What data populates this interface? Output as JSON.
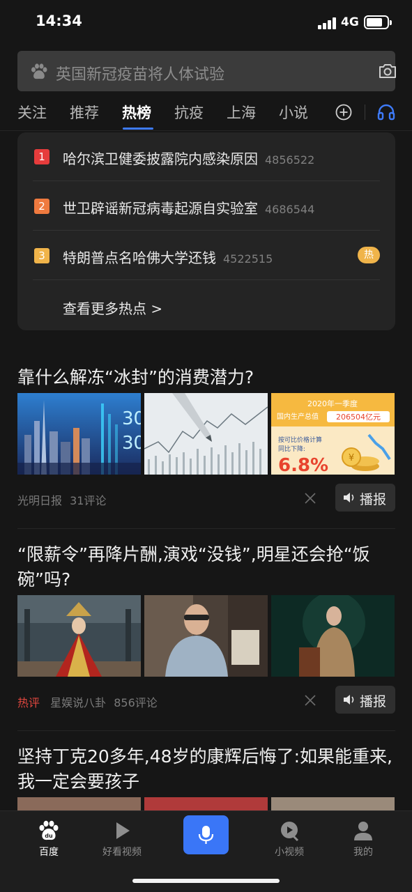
{
  "status_bar": {
    "time": "14:34",
    "network": "4G"
  },
  "search": {
    "query": "英国新冠疫苗将人体试验",
    "left_icon": "baidu-paw-icon",
    "right_icon": "camera-icon"
  },
  "tabs": {
    "items": [
      "关注",
      "推荐",
      "热榜",
      "抗疫",
      "上海",
      "小说"
    ],
    "active_index": 2,
    "accent": "#3e7bfa"
  },
  "hot_list": {
    "items": [
      {
        "rank": "1",
        "title": "哈尔滨卫健委披露院内感染原因",
        "count": "4856522",
        "rank_color": "#e63c3c"
      },
      {
        "rank": "2",
        "title": "世卫辟谣新冠病毒起源自实验室",
        "count": "4686544",
        "rank_color": "#ef7a3f"
      },
      {
        "rank": "3",
        "title": "特朗普点名哈佛大学还钱",
        "count": "4522515",
        "rank_color": "#f0b44a",
        "badge": "热"
      }
    ],
    "more_label": "查看更多热点 >"
  },
  "news": [
    {
      "title": "靠什么解冻“冰封”的消费潜力?",
      "thumb3": {
        "year": "2020年一季度",
        "gdp_label": "国内生产总值",
        "gdp_value": "206504亿元",
        "calc": "按可比价格计算",
        "change": "同比下降:",
        "percent": "6.8%"
      },
      "source": "光明日报",
      "comments": "31评论",
      "play_label": "播报"
    },
    {
      "title": "“限薪令”再降片酬,演戏“没钱”,明星还会抢“饭碗”吗?",
      "tag": "热评",
      "source": "星娱说八卦",
      "comments": "856评论",
      "play_label": "播报"
    },
    {
      "title": "坚持丁克20多年,48岁的康辉后悔了:如果能重来,我一定会要孩子"
    }
  ],
  "bottom_nav": {
    "items": [
      {
        "label": "百度",
        "icon": "baidu-paw-icon"
      },
      {
        "label": "好看视频",
        "icon": "play-triangle-icon"
      },
      {
        "label": "",
        "icon": "microphone-icon"
      },
      {
        "label": "小视频",
        "icon": "mini-video-icon"
      },
      {
        "label": "我的",
        "icon": "user-icon"
      }
    ],
    "active_index": 0,
    "voice_color": "#3a76f7"
  }
}
